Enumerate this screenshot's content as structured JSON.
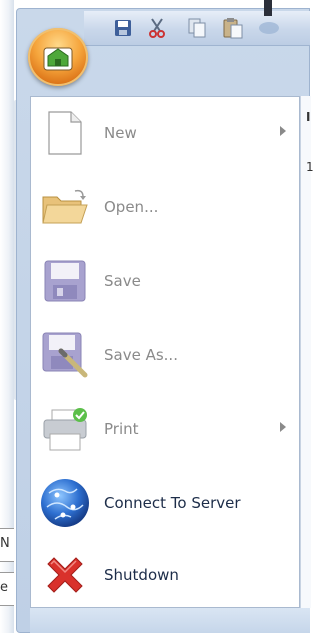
{
  "app": {
    "quick_access": [
      "save-icon",
      "cut-icon",
      "copy-icon",
      "paste-icon",
      "dropdown-icon"
    ]
  },
  "menu": {
    "items": [
      {
        "label": "New",
        "icon": "new-document-icon",
        "enabled": false,
        "submenu": true
      },
      {
        "label": "Open...",
        "icon": "open-folder-icon",
        "enabled": false,
        "submenu": false
      },
      {
        "label": "Save",
        "icon": "save-icon",
        "enabled": false,
        "submenu": false
      },
      {
        "label": "Save As...",
        "icon": "save-as-icon",
        "enabled": false,
        "submenu": false
      },
      {
        "label": "Print",
        "icon": "print-icon",
        "enabled": false,
        "submenu": true
      },
      {
        "label": "Connect To Server",
        "icon": "globe-icon",
        "enabled": true,
        "submenu": false
      },
      {
        "label": "Shutdown",
        "icon": "shutdown-x-icon",
        "enabled": true,
        "submenu": false
      }
    ]
  },
  "background_fragments": {
    "right_top": "I",
    "right_second": "1",
    "left_first": "N",
    "left_second": "e"
  },
  "colors": {
    "orb": "#f5a43b",
    "enabled_text": "#1d2d49",
    "disabled_text": "#8a8a8a",
    "shutdown_red": "#d9312b"
  }
}
